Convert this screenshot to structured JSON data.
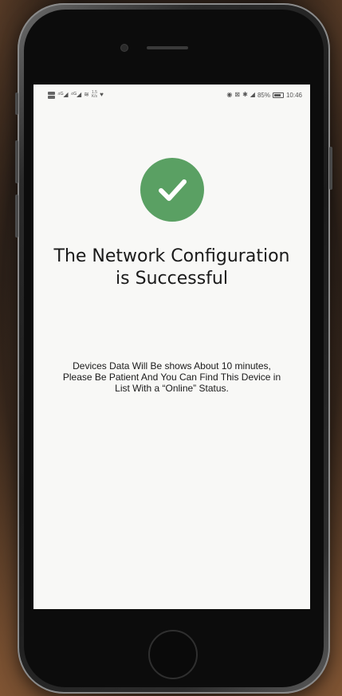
{
  "status_bar": {
    "left_glyphs": [
      "⁴ᴳ◢",
      "⁴ᴳ◢",
      "≋"
    ],
    "speed": "1.5",
    "speed_unit": "K/s",
    "heart": "♥",
    "right_glyphs": [
      "◉",
      "⊠",
      "✱",
      "◢"
    ],
    "battery_text": "85%",
    "battery_level": 0.85,
    "time": "10:46"
  },
  "success": {
    "icon": "checkmark-icon",
    "badge_color": "#5aa063",
    "title_line1": "The Network Configuration",
    "title_line2": "is Successful",
    "message_line1": "Devices Data Will Be shows About 10 minutes,",
    "message_line2": "Please Be Patient And You Can Find This Device in",
    "message_line3": "List With a “Online” Status."
  }
}
